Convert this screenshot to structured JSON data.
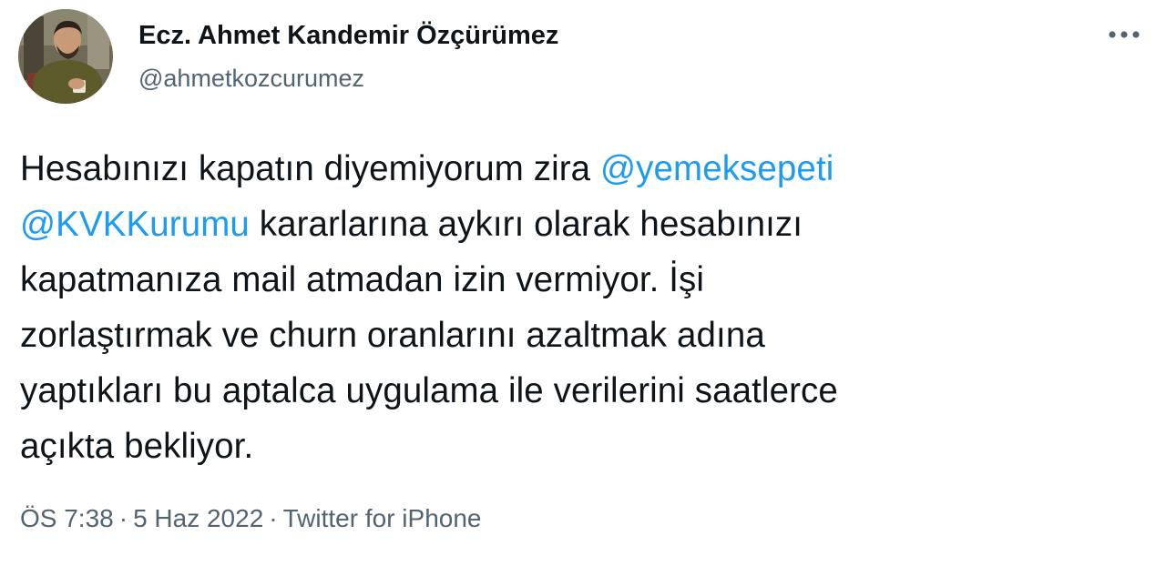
{
  "author": {
    "display_name": "Ecz. Ahmet Kandemir Özçürümez",
    "handle": "@ahmetkozcurumez",
    "avatar_icon": "profile-photo"
  },
  "more_icon": "more-horizontal-icon",
  "tweet": {
    "lines": [
      [
        {
          "text": "Hesabınızı kapatın diyemiyorum zira ",
          "mention": false
        },
        {
          "text": "@yemeksepeti",
          "mention": true
        }
      ],
      [
        {
          "text": "@KVKKurumu",
          "mention": true
        },
        {
          "text": " kararlarına aykırı olarak hesabınızı",
          "mention": false
        }
      ],
      [
        {
          "text": "kapatmanıza mail atmadan izin vermiyor. İşi",
          "mention": false
        }
      ],
      [
        {
          "text": "zorlaştırmak ve churn oranlarını azaltmak adına",
          "mention": false
        }
      ],
      [
        {
          "text": "yaptıkları bu aptalca uygulama ile verilerini saatlerce",
          "mention": false
        }
      ],
      [
        {
          "text": "açıkta bekliyor.",
          "mention": false
        }
      ]
    ]
  },
  "meta": {
    "time": "ÖS 7:38",
    "separator": "·",
    "date": "5 Haz 2022",
    "source": "Twitter for iPhone"
  },
  "colors": {
    "text": "#0f1419",
    "secondary": "#536471",
    "mention": "#1d9bf0"
  }
}
